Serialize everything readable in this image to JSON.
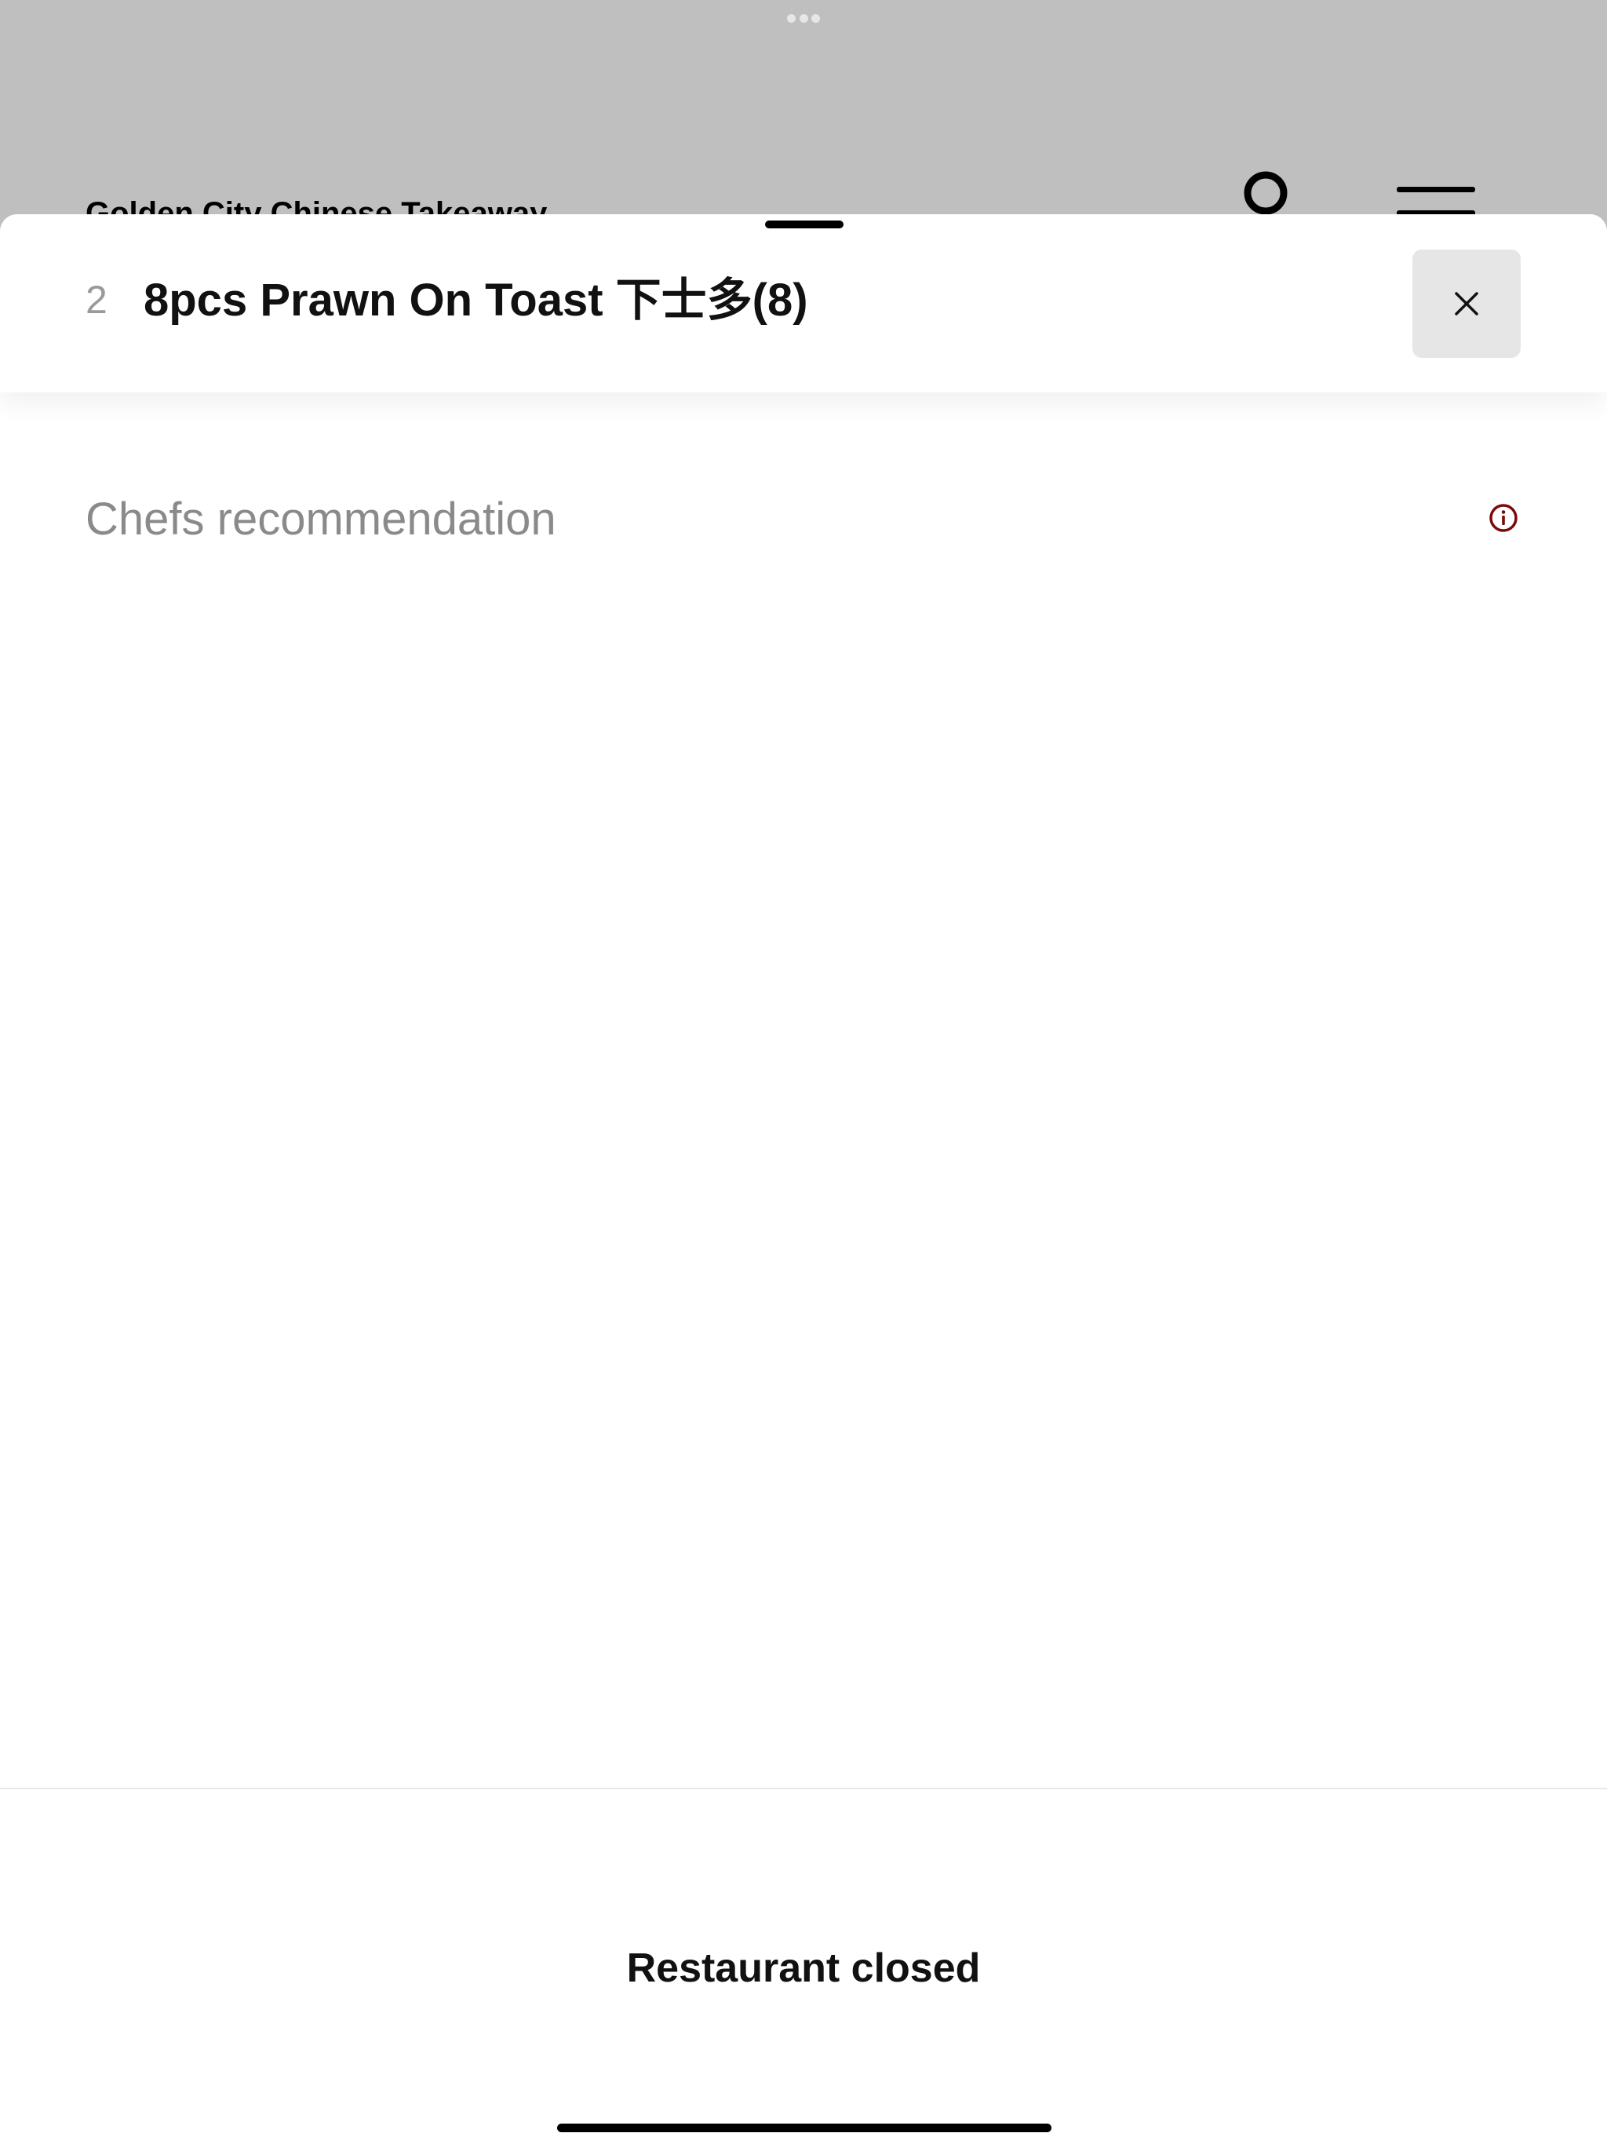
{
  "background": {
    "restaurant_name": "Golden City Chinese Takeaway",
    "icons": [
      "account-icon",
      "menu-icon",
      "multitask-dots-icon"
    ]
  },
  "item": {
    "number": "2",
    "title": "8pcs Prawn On Toast 下士多(8)",
    "close_icon": "close-icon"
  },
  "category": {
    "label": "Chefs recommendation",
    "info_icon": "info-icon"
  },
  "footer": {
    "status": "Restaurant closed"
  },
  "colors": {
    "accent": "#7a0a0a",
    "overlay": "#bfbfbf",
    "close_bg": "#e6e6e6"
  }
}
